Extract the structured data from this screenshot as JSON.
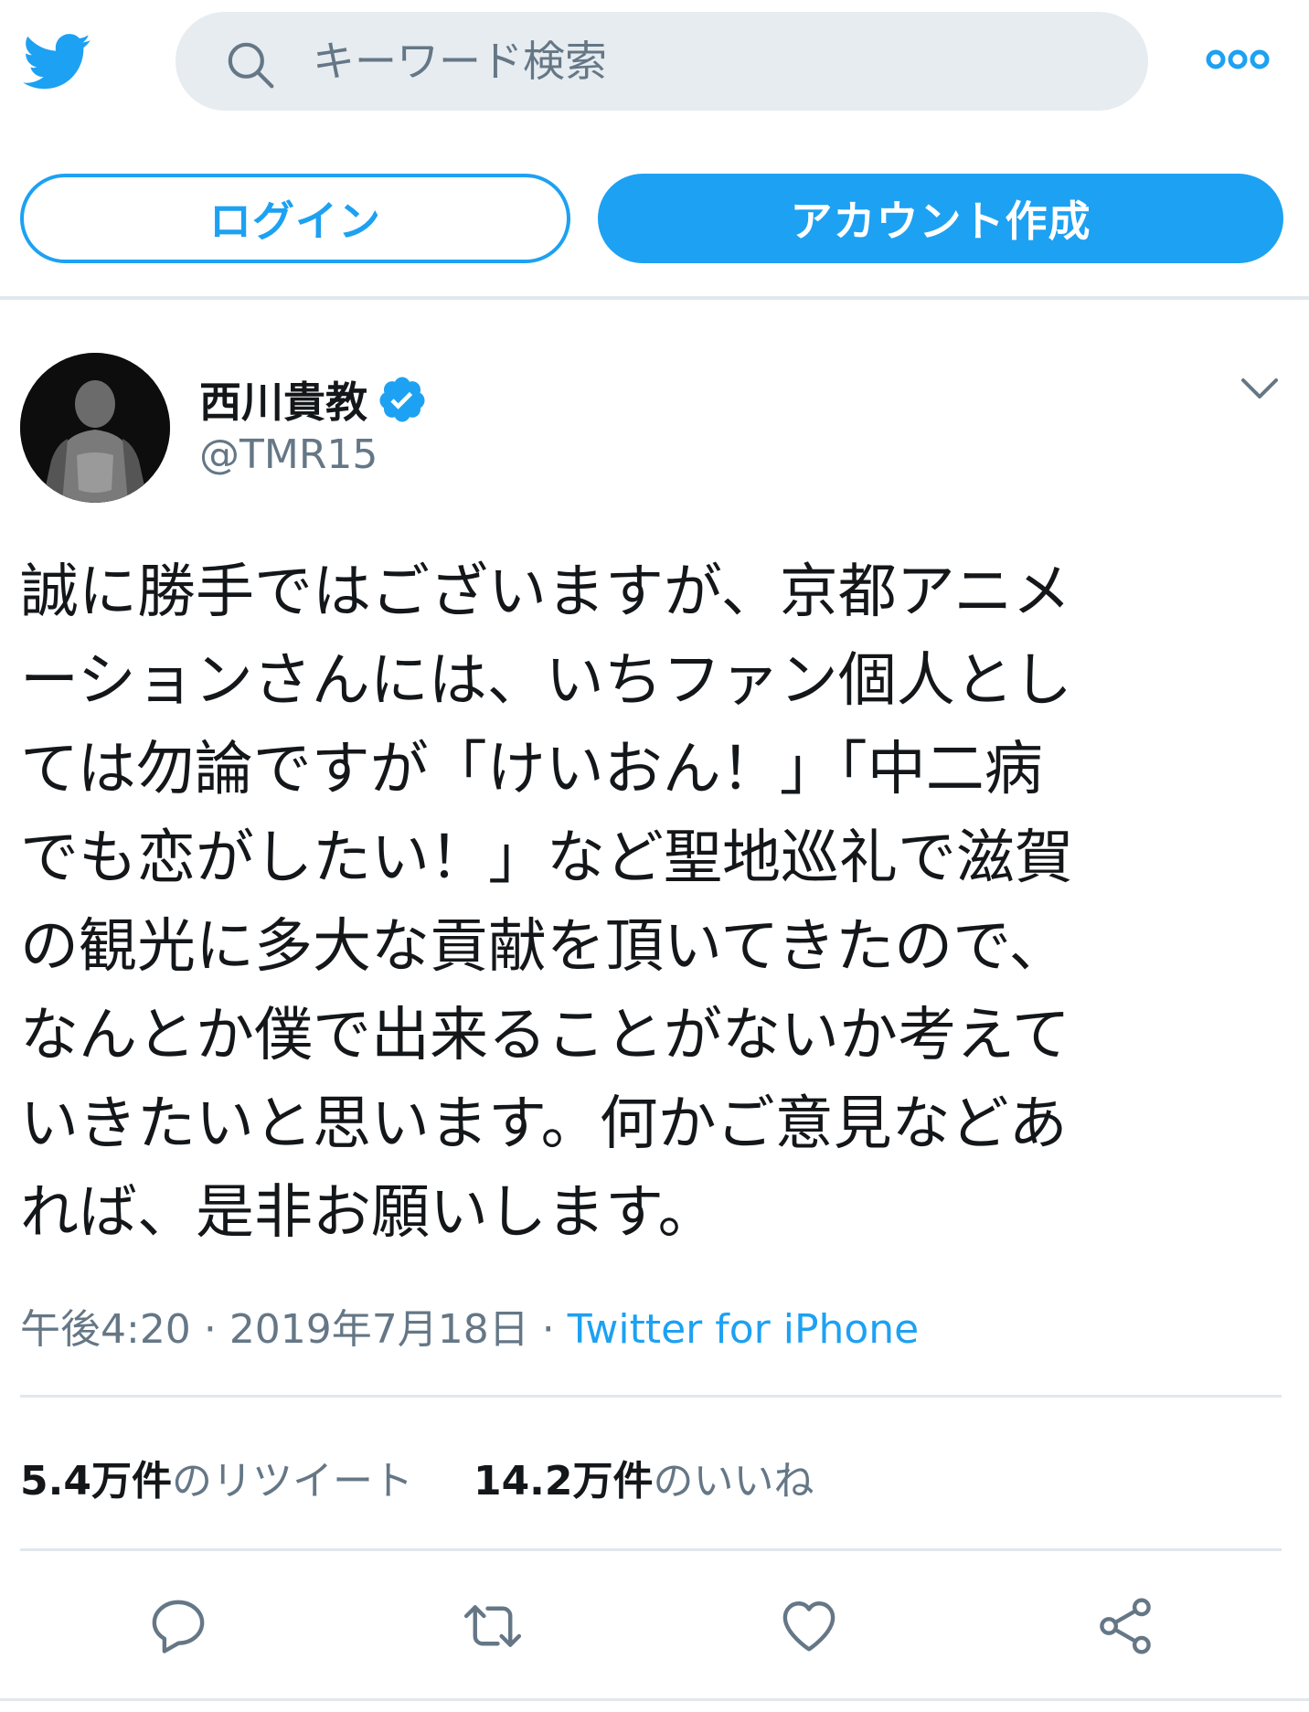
{
  "header": {
    "logo_icon": "twitter-bird-icon",
    "search_placeholder": "キーワード検索",
    "search_icon": "search-icon",
    "more_icon": "more-dots-icon",
    "brand_color": "#1da1f2"
  },
  "auth": {
    "login_label": "ログイン",
    "signup_label": "アカウント作成"
  },
  "tweet": {
    "author_name": "西川貴教",
    "author_handle": "@TMR15",
    "verified_icon": "verified-badge-icon",
    "menu_icon": "chevron-down-icon",
    "text": "誠に勝手ではございますが、京都アニメ\nーションさんには、いちファン個人とし\nては勿論ですが「けいおん！」「中二病\nでも恋がしたい！」など聖地巡礼で滋賀\nの観光に多大な貢献を頂いてきたので、\nなんとか僕で出来ることがないか考えて\nいきたいと思います。何かご意見などあ\nれば、是非お願いします。",
    "time": "午後4:20",
    "date": "2019年7月18日",
    "separator": "·",
    "source": "Twitter for iPhone",
    "retweet_count": "5.4万件",
    "retweet_label": "のリツイート",
    "like_count": "14.2万件",
    "like_label": "のいいね"
  },
  "actions": {
    "reply_icon": "reply-icon",
    "retweet_icon": "retweet-icon",
    "like_icon": "heart-icon",
    "share_icon": "share-icon"
  }
}
